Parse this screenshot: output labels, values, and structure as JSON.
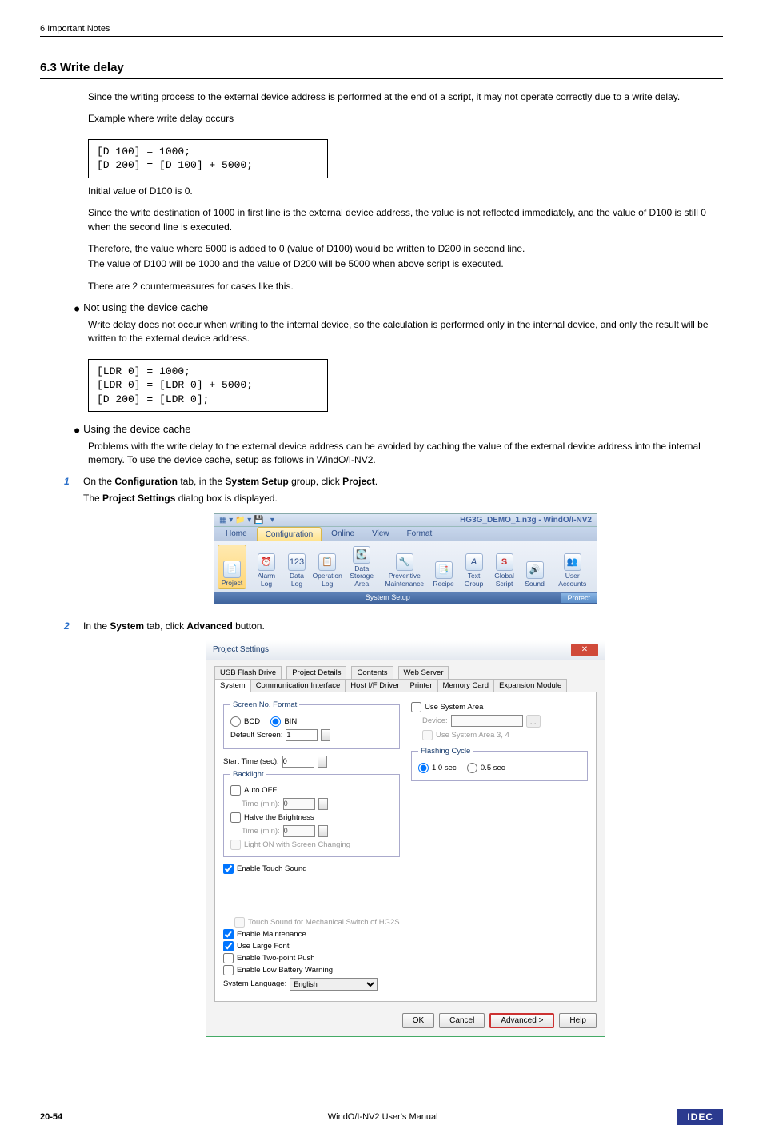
{
  "header": "6 Important Notes",
  "section_title": "6.3   Write delay",
  "intro": "Since the writing process to the external device address is performed at the end of a script, it may not operate correctly due to a write delay.",
  "example_label": "Example where write delay occurs",
  "code1": "[D 100] = 1000;\n[D 200] = [D 100] + 5000;",
  "initial_line": "Initial value of D100 is 0.",
  "explain1": "Since the write destination of 1000 in first line is the external device address, the value is not reflected immediately, and the value of D100 is still 0 when the second line is executed.",
  "explain2": "Therefore, the value where 5000 is added to 0 (value of D100) would be written to D200 in second line.",
  "explain3": "The value of D100 will be 1000 and the value of D200 will be 5000 when above script is executed.",
  "counter_line": "There are 2 countermeasures for cases like this.",
  "bullet1_title": "Not using the device cache",
  "bullet1_text": "Write delay does not occur when writing to the internal device, so the calculation is performed only in the internal device, and only the result will be written to the external device address.",
  "code2": "[LDR 0] = 1000;\n[LDR 0] = [LDR 0] + 5000;\n[D 200] = [LDR 0];",
  "bullet2_title": "Using the device cache",
  "bullet2_text": "Problems with the write delay to the external device address can be avoided by caching the value of the external device address into the internal memory. To use the device cache, setup as follows in WindO/I-NV2.",
  "step1_num": "1",
  "step1_a": "On the ",
  "step1_b": "Configuration",
  "step1_c": " tab, in the ",
  "step1_d": "System Setup",
  "step1_e": " group, click ",
  "step1_f": "Project",
  "step1_g": ".",
  "step1_sub_a": "The ",
  "step1_sub_b": "Project Settings",
  "step1_sub_c": " dialog box is displayed.",
  "step2_num": "2",
  "step2_a": "In the ",
  "step2_b": "System",
  "step2_c": " tab, click ",
  "step2_d": "Advanced",
  "step2_e": " button.",
  "ribbon": {
    "window_title": "HG3G_DEMO_1.n3g - WindO/I-NV2",
    "tabs": {
      "home": "Home",
      "configuration": "Configuration",
      "online": "Online",
      "view": "View",
      "format": "Format"
    },
    "buttons": {
      "project": "Project",
      "alarm": "Alarm\nLog",
      "data": "Data\nLog",
      "operation": "Operation\nLog",
      "storage": "Data\nStorage Area",
      "preventive": "Preventive\nMaintenance",
      "recipe": "Recipe",
      "text": "Text\nGroup",
      "global": "Global\nScript",
      "sound": "Sound",
      "user": "User\nAccounts"
    },
    "footer_label": "System Setup",
    "footer_protect": "Protect"
  },
  "dialog": {
    "title": "Project Settings",
    "tabs_row1": {
      "usb": "USB Flash Drive",
      "details": "Project Details",
      "contents": "Contents",
      "web": "Web Server"
    },
    "tabs_row2": {
      "system": "System",
      "comm": "Communication Interface",
      "host": "Host I/F Driver",
      "printer": "Printer",
      "memory": "Memory Card",
      "expansion": "Expansion Module"
    },
    "screen_no_format": "Screen No. Format",
    "bcd": "BCD",
    "bin": "BIN",
    "default_screen": "Default Screen:",
    "default_screen_val": "1",
    "start_time": "Start Time (sec):",
    "start_time_val": "0",
    "backlight": "Backlight",
    "auto_off": "Auto OFF",
    "time_min": "Time (min):",
    "time_val": "0",
    "halve": "Halve the Brightness",
    "light_on": "Light ON with Screen Changing",
    "use_system_area": "Use System Area",
    "device": "Device:",
    "use_system_area34": "Use System Area 3, 4",
    "flashing_cycle": "Flashing Cycle",
    "fc10": "1.0 sec",
    "fc05": "0.5 sec",
    "enable_touch": "Enable Touch Sound",
    "touch_mech": "Touch Sound for Mechanical Switch of HG2S",
    "enable_maint": "Enable Maintenance",
    "use_large": "Use Large Font",
    "enable_twopoint": "Enable Two-point Push",
    "enable_lowbatt": "Enable Low Battery Warning",
    "syslang": "System Language:",
    "syslang_val": "English",
    "btn_ok": "OK",
    "btn_cancel": "Cancel",
    "btn_advanced": "Advanced >",
    "btn_help": "Help"
  },
  "footer": {
    "page": "20-54",
    "manual": "WindO/I-NV2 User's Manual",
    "brand": "IDEC"
  }
}
